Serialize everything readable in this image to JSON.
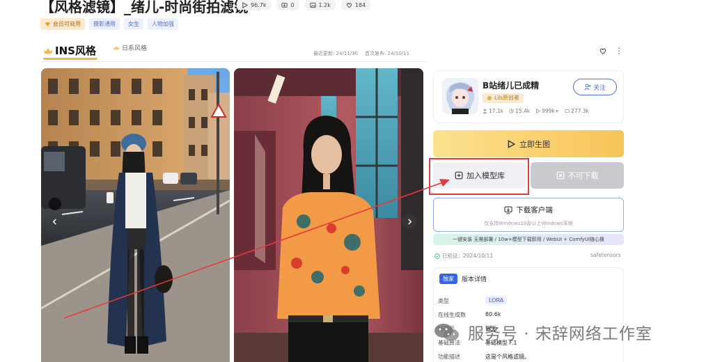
{
  "header": {
    "title": "【风格滤镜】_绪儿-时尚街拍滤镜",
    "stats": [
      {
        "icon": "play-icon",
        "value": "96.7k"
      },
      {
        "icon": "download-icon",
        "value": "0"
      },
      {
        "icon": "image-icon",
        "value": "1.2k"
      },
      {
        "icon": "heart-icon",
        "value": "184"
      }
    ],
    "tags": [
      "会员可商用",
      "摄影通用",
      "女生",
      "人物加强"
    ]
  },
  "versions": {
    "active": "INS风格",
    "other": "日系风格",
    "updated": "最近更新: 24/11/30",
    "published": "首次发布: 24/10/11",
    "more": "⋮"
  },
  "creator": {
    "name": "B站绪儿已成精",
    "badge": "Lib原创者",
    "follow_label": "关注",
    "stats": [
      "17.1k",
      "15.4k",
      "999k+",
      "277.3k"
    ]
  },
  "actions": {
    "generate": "立即生图",
    "add_library": "加入模型库",
    "no_download": "不可下载",
    "client_title": "下载客户端",
    "client_sub": "仅支持Windows10及以上Windows系统",
    "promo": "一键安装 无需部署 / 10w+模型下载即用 / WebUI + ComfyUI随心换"
  },
  "meta": {
    "verified": "已验证：2024/10/11",
    "format": "safetensors"
  },
  "details": {
    "exclusive": "独家",
    "title": "版本详情",
    "rows": [
      {
        "label": "类型",
        "value": "LORA"
      },
      {
        "label": "在线生成数",
        "value": "80.6k"
      },
      {
        "label": "标识号",
        "value": "暂无"
      },
      {
        "label": "基础算法",
        "value": "基础模型 F.1"
      },
      {
        "label": "功能描述",
        "value": "这是个风格滤镜。"
      }
    ]
  },
  "watermark": "服务号 · 宋辞网络工作室",
  "colors": {
    "accent_blue": "#4f6fd8",
    "generate_yellow": "#f7c458",
    "highlight_red": "#e53a3a",
    "tab_underline": "#f5b547"
  }
}
